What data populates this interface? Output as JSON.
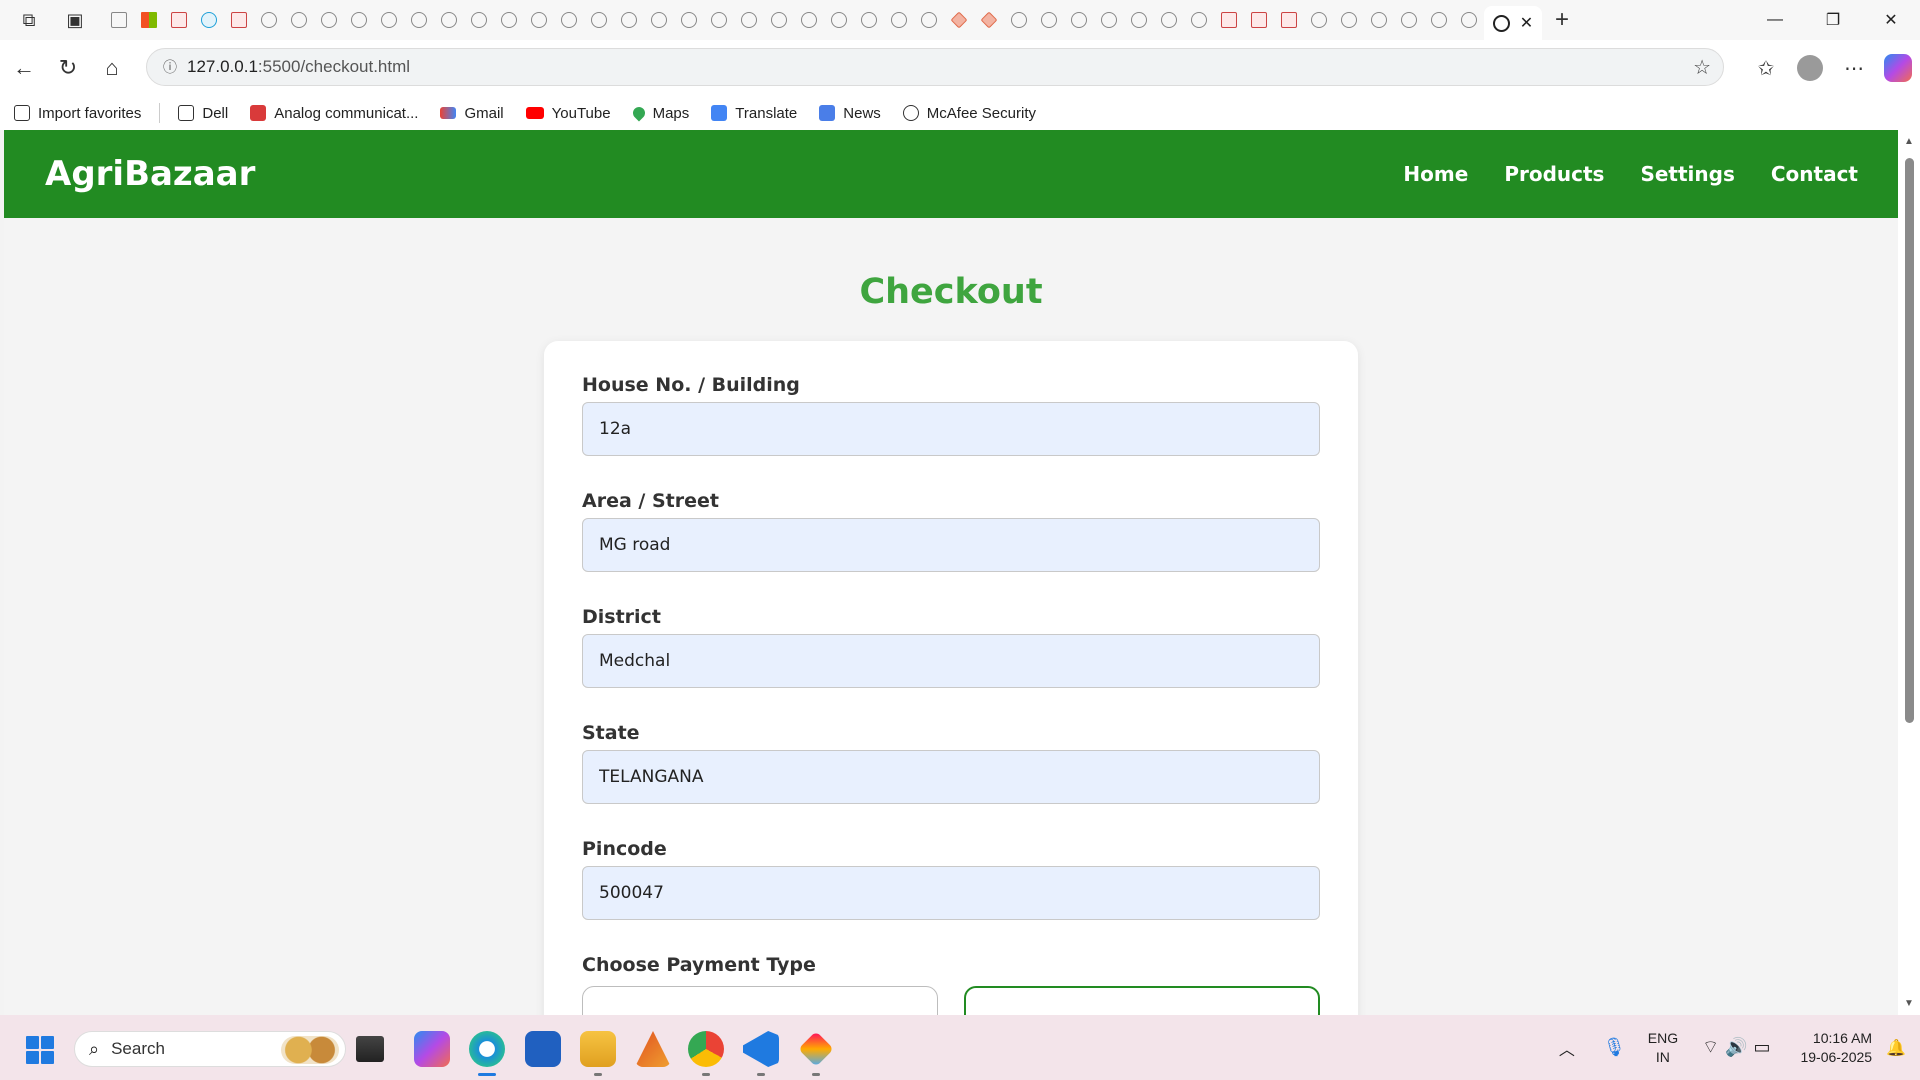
{
  "browser": {
    "active_tab_icon": "globe-icon",
    "url_host": "127.0.0.1",
    "url_path": ":5500/checkout.html",
    "favorites": [
      {
        "label": "Import favorites",
        "icon": "import-icon"
      },
      {
        "label": "Dell",
        "icon": "folder-icon"
      },
      {
        "label": "Analog communicat...",
        "icon": "pdf-icon"
      },
      {
        "label": "Gmail",
        "icon": "gmail-icon"
      },
      {
        "label": "YouTube",
        "icon": "youtube-icon"
      },
      {
        "label": "Maps",
        "icon": "maps-icon"
      },
      {
        "label": "Translate",
        "icon": "translate-icon"
      },
      {
        "label": "News",
        "icon": "news-icon"
      },
      {
        "label": "McAfee Security",
        "icon": "globe-icon"
      }
    ]
  },
  "site": {
    "brand": "AgriBazaar",
    "nav": [
      "Home",
      "Products",
      "Settings",
      "Contact"
    ],
    "brand_color": "#228b22",
    "title_color": "#3fa53f"
  },
  "checkout": {
    "title": "Checkout",
    "fields": [
      {
        "label": "House No. / Building",
        "value": "12a"
      },
      {
        "label": "Area / Street",
        "value": "MG road"
      },
      {
        "label": "District",
        "value": "Medchal"
      },
      {
        "label": "State",
        "value": "TELANGANA"
      },
      {
        "label": "Pincode",
        "value": "500047"
      }
    ],
    "payment_label": "Choose Payment Type"
  },
  "taskbar": {
    "search_placeholder": "Search",
    "lang_line1": "ENG",
    "lang_line2": "IN",
    "time": "10:16 AM",
    "date": "19-06-2025"
  }
}
